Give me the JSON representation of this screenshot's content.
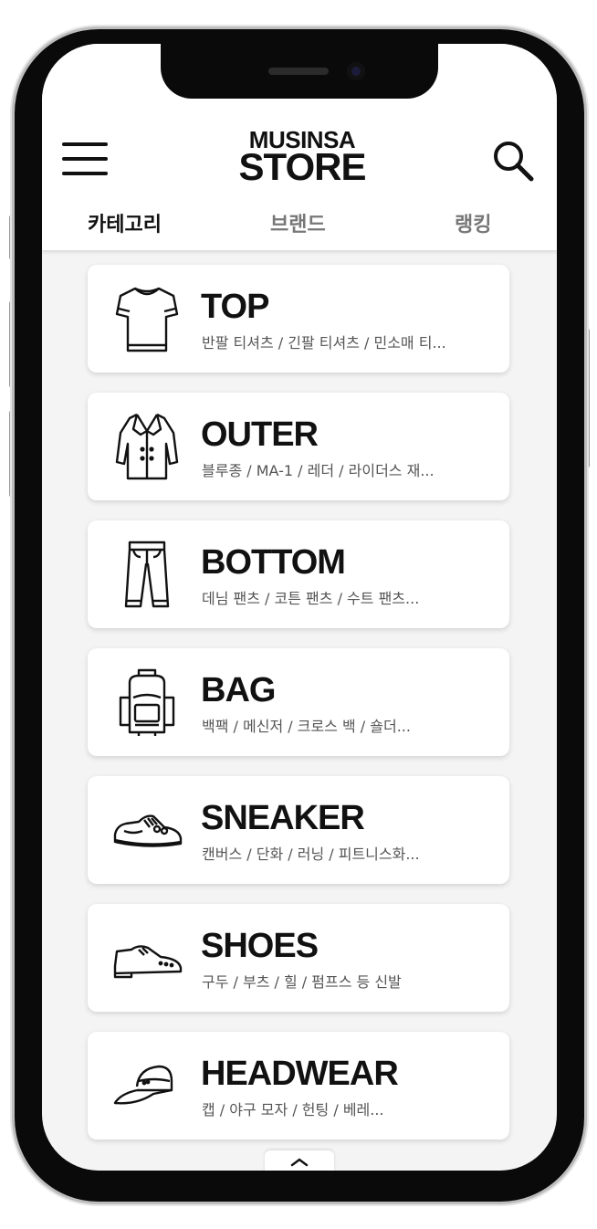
{
  "header": {
    "logo_line1": "MUSINSA",
    "logo_line2": "STORE",
    "menu_icon": "hamburger-icon",
    "search_icon": "search-icon"
  },
  "tabs": [
    {
      "label": "카테고리",
      "active": true
    },
    {
      "label": "브랜드",
      "active": false
    },
    {
      "label": "랭킹",
      "active": false
    }
  ],
  "categories": [
    {
      "title": "TOP",
      "subtitle": "반팔 티셔츠 / 긴팔 티셔츠 / 민소매 티...",
      "icon": "tshirt-icon"
    },
    {
      "title": "OUTER",
      "subtitle": "블루종 / MA-1 / 레더 / 라이더스 재...",
      "icon": "coat-icon"
    },
    {
      "title": "BOTTOM",
      "subtitle": "데님 팬츠 / 코튼 팬츠 / 수트 팬츠...",
      "icon": "pants-icon"
    },
    {
      "title": "BAG",
      "subtitle": "백팩 / 메신저 / 크로스 백 / 숄더...",
      "icon": "backpack-icon"
    },
    {
      "title": "SNEAKER",
      "subtitle": "캔버스 / 단화 / 러닝 / 피트니스화...",
      "icon": "sneaker-icon"
    },
    {
      "title": "SHOES",
      "subtitle": "구두 / 부츠 / 힐 / 펌프스 등 신발",
      "icon": "dress-shoe-icon"
    },
    {
      "title": "HEADWEAR",
      "subtitle": "캡 / 야구 모자 / 헌팅 / 베레...",
      "icon": "cap-icon"
    }
  ],
  "scroll_top_icon": "chevron-up-icon"
}
